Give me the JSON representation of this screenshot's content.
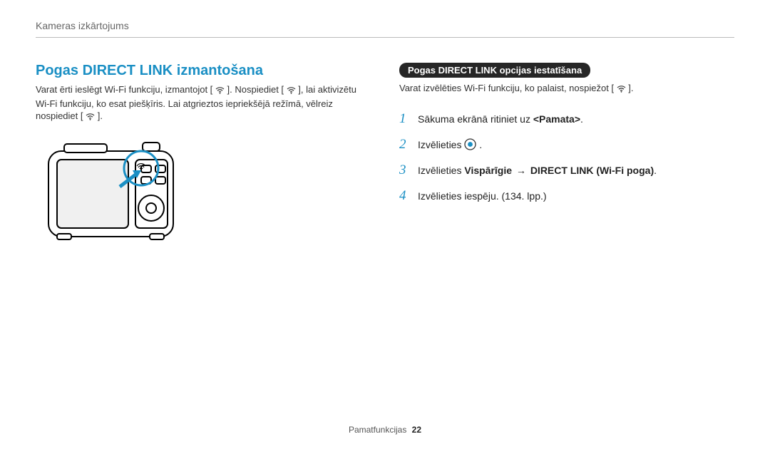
{
  "header": {
    "breadcrumb": "Kameras izkārtojums"
  },
  "left": {
    "title": "Pogas DIRECT LINK izmantošana",
    "body_part1": "Varat ērti ieslēgt Wi-Fi funkciju, izmantojot [",
    "body_part2": "]. Nospiediet [",
    "body_part3": "], lai aktivizētu Wi-Fi funkciju, ko esat piešķīris. Lai atgrieztos iepriekšējā režīmā, vēlreiz nospiediet [",
    "body_part4": "]."
  },
  "right": {
    "badge": "Pogas DIRECT LINK opcijas iestatīšana",
    "intro_part1": "Varat izvēlēties Wi-Fi funkciju, ko palaist, nospiežot [",
    "intro_part2": "].",
    "steps": [
      {
        "num": "1",
        "pre": "Sākuma ekrānā ritiniet uz ",
        "bold": "<Pamata>",
        "post": "."
      },
      {
        "num": "2",
        "pre": "Izvēlieties ",
        "icon": true,
        "post": " ."
      },
      {
        "num": "3",
        "pre": "Izvēlieties ",
        "bold": "Vispārīgie",
        "arrow": " → ",
        "bold2": "DIRECT LINK (Wi-Fi poga)",
        "post": "."
      },
      {
        "num": "4",
        "pre": "Izvēlieties iespēju. (134. lpp.)"
      }
    ]
  },
  "footer": {
    "section": "Pamatfunkcijas",
    "page": "22"
  }
}
